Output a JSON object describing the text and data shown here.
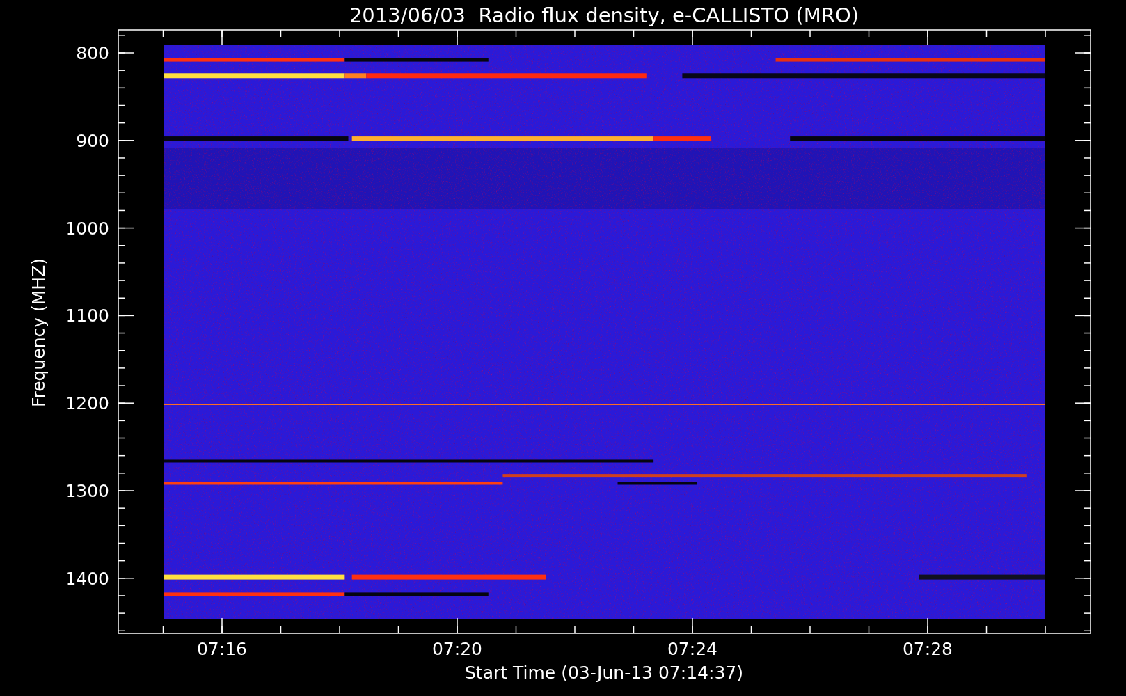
{
  "title": "2013/06/03  Radio flux density, e-CALLISTO (MRO)",
  "x_axis": {
    "label": "Start Time (03-Jun-13 07:14:37)",
    "ticks": [
      "07:16",
      "07:20",
      "07:24",
      "07:28"
    ]
  },
  "y_axis": {
    "label": "Frequency (MHZ)",
    "ticks": [
      "800",
      "900",
      "1000",
      "1100",
      "1200",
      "1300",
      "1400"
    ]
  }
}
